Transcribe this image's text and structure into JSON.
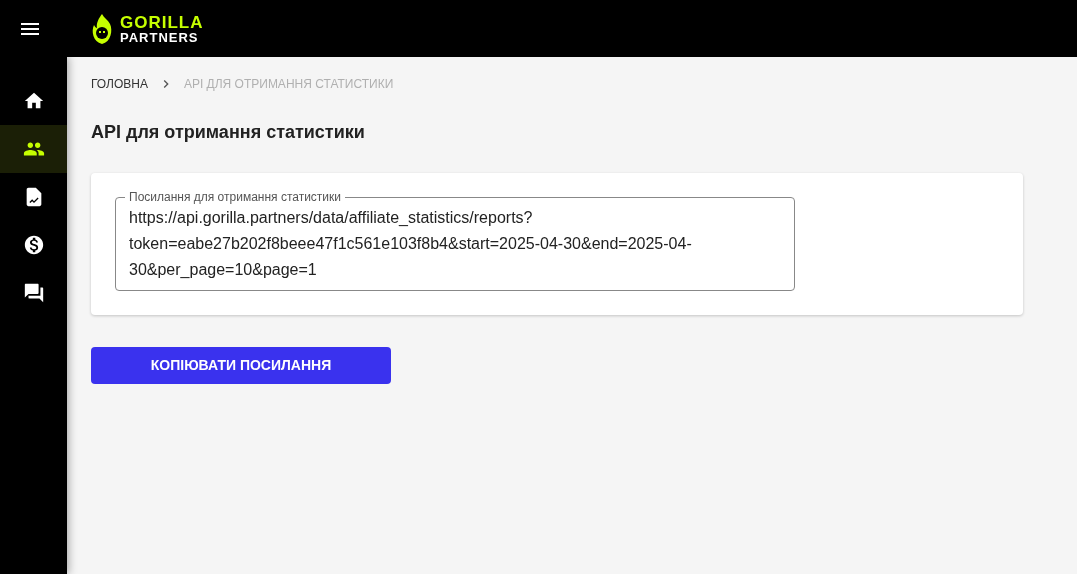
{
  "header": {
    "logo": {
      "line_1": "GORILLA",
      "line_2": "PARTNERS"
    }
  },
  "sidebar": {
    "items": [
      {
        "selected": false
      },
      {
        "selected": true
      },
      {
        "selected": false
      },
      {
        "selected": false
      },
      {
        "selected": false
      }
    ]
  },
  "breadcrumbs": [
    {
      "label": "ГОЛОВНА",
      "selected": false
    },
    {
      "label": "API ДЛЯ ОТРИМАННЯ СТАТИСТИКИ",
      "selected": true
    }
  ],
  "page_title": "API для отримання статистики",
  "link_field": {
    "label": "Посилання для отримання статистики",
    "value": "https://api.gorilla.partners/data/affiliate_statistics/reports?token=eabe27b202f8beee47f1c561e103f8b4&start=2025-04-30&end=2025-04-30&per_page=10&page=1"
  },
  "copy_button": "КОПІЮВАТИ ПОСИЛАННЯ"
}
